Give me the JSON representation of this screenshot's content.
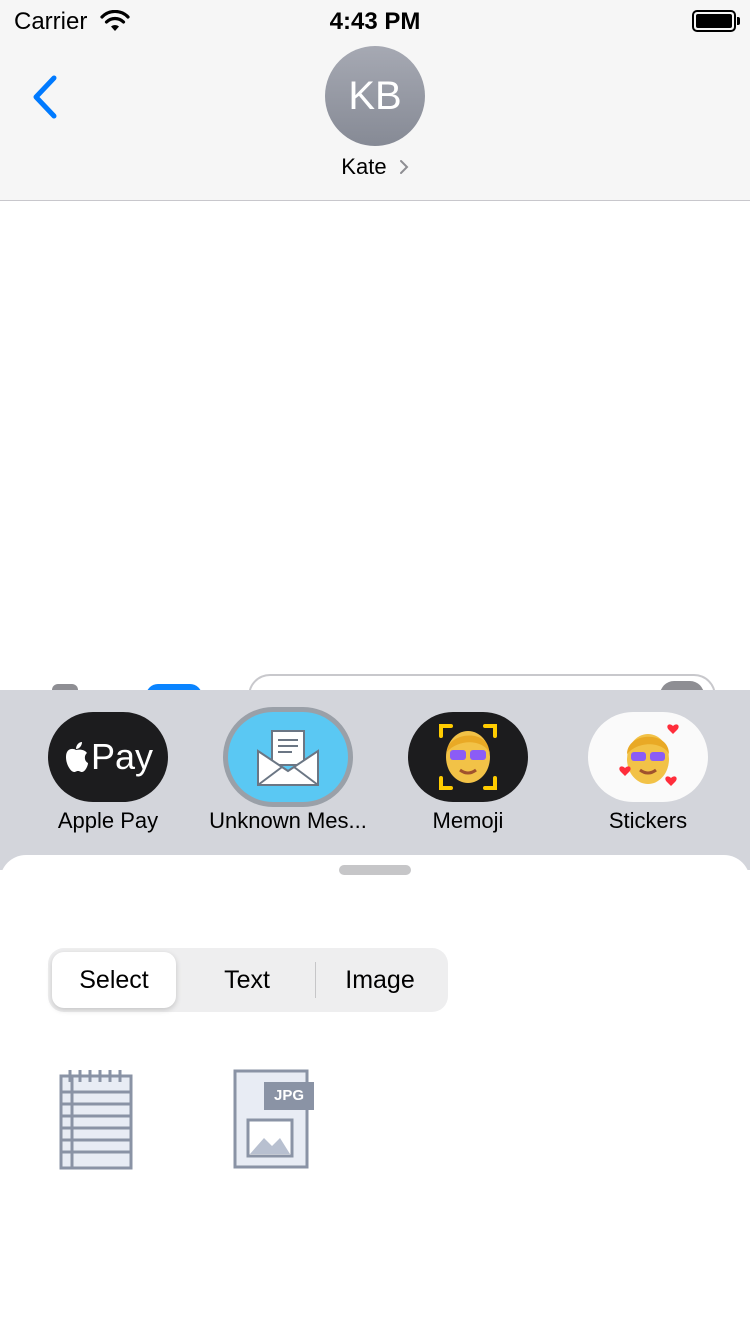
{
  "status_bar": {
    "carrier": "Carrier",
    "time": "4:43 PM"
  },
  "header": {
    "avatar_initials": "KB",
    "contact_name": "Kate"
  },
  "apps": [
    {
      "label": "Apple Pay",
      "icon_text": "Pay",
      "icon": "apple-pay-icon"
    },
    {
      "label": "Unknown Mes...",
      "icon": "envelope-icon"
    },
    {
      "label": "Memoji",
      "icon": "memoji-icon"
    },
    {
      "label": "Stickers",
      "icon": "sticker-icon"
    }
  ],
  "segmented_control": {
    "options": [
      "Select",
      "Text",
      "Image"
    ],
    "selected": "Select"
  },
  "files": [
    {
      "icon": "notepad-icon"
    },
    {
      "icon": "jpg-file-icon",
      "badge": "JPG"
    }
  ],
  "colors": {
    "accent": "#007aff",
    "drawer_bg": "#d3d5db",
    "header_bg": "#f6f6f6"
  }
}
